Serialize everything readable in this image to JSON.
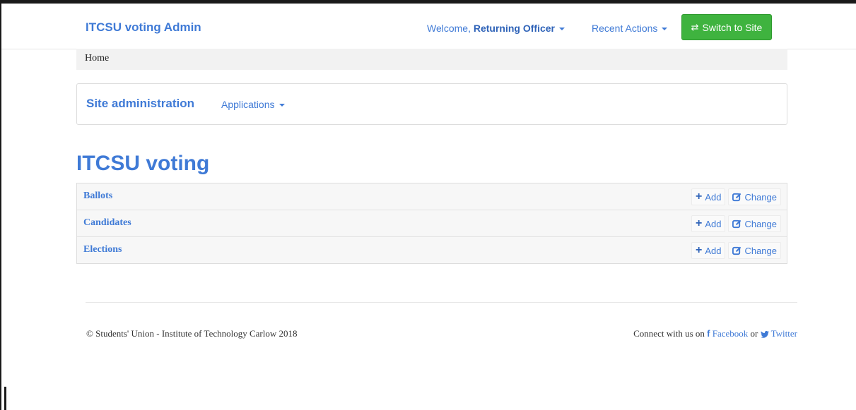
{
  "navbar": {
    "brand": "ITCSU voting Admin",
    "welcome_prefix": "Welcome,",
    "welcome_user": "Returning Officer",
    "recent_actions": "Recent Actions",
    "switch_button": "Switch to Site",
    "switch_icon": "swap-arrows-icon"
  },
  "breadcrumb": {
    "home": "Home"
  },
  "subnav": {
    "title": "Site administration",
    "applications": "Applications"
  },
  "app": {
    "title": "ITCSU voting",
    "models": [
      {
        "name": "Ballots",
        "add": "Add",
        "change": "Change"
      },
      {
        "name": "Candidates",
        "add": "Add",
        "change": "Change"
      },
      {
        "name": "Elections",
        "add": "Add",
        "change": "Change"
      }
    ]
  },
  "footer": {
    "copyright": "© Students' Union - Institute of Technology Carlow 2018",
    "connect_prefix": "Connect with us on",
    "facebook": "Facebook",
    "or": "or",
    "twitter": "Twitter"
  },
  "colors": {
    "link": "#3f7ad6",
    "success": "#3fb33f",
    "breadcrumb_bg": "#f2f2f2"
  }
}
